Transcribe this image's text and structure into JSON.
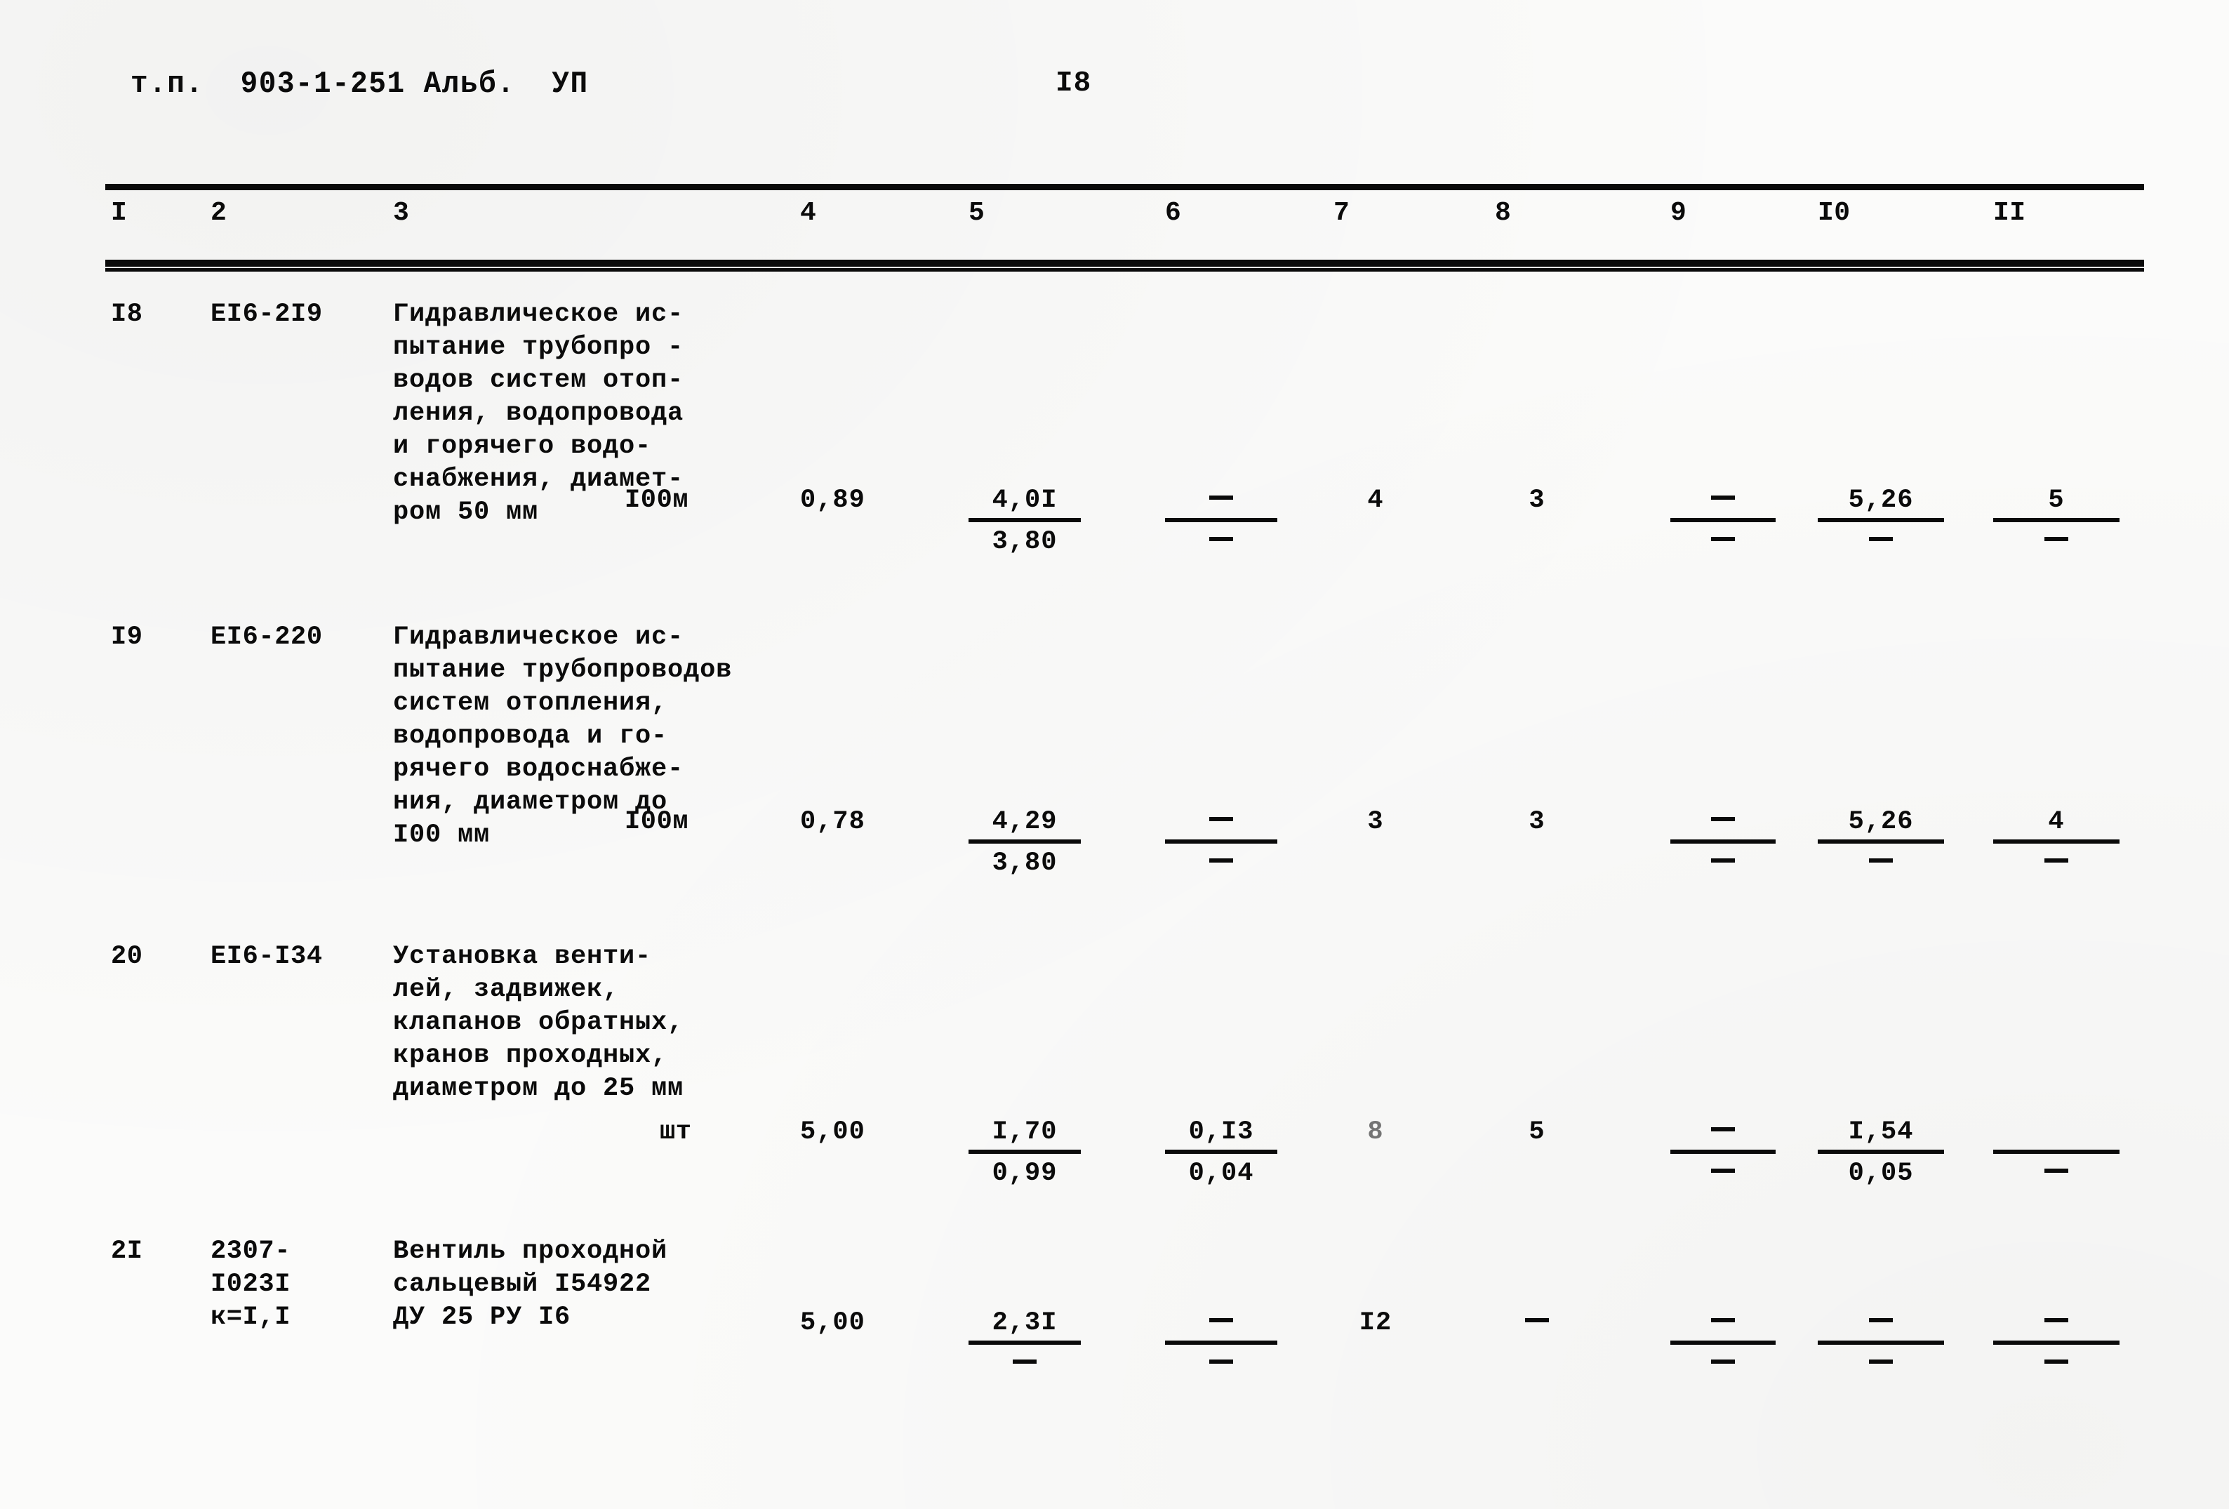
{
  "header": {
    "doc_code": "т.п.  903-1-251 Альб.  УП",
    "page_number": "I8"
  },
  "table": {
    "column_headers": [
      "I",
      "2",
      "3",
      "4",
      "5",
      "6",
      "7",
      "8",
      "9",
      "I0",
      "II"
    ],
    "rows": [
      {
        "no": "I8",
        "code": "ЕI6-2I9",
        "description": "Гидравлическое ис-\nпытание трубопро -\nводов систем отоп-\nления, водопровода\nи горячего водо-\nснабжения, диамет-\nром 50 мм",
        "unit": "I00м",
        "c4": "0,89",
        "c5_top": "4,0I",
        "c5_bot": "3,80",
        "c6_top": "—",
        "c6_bot": "—",
        "c7": "4",
        "c8": "3",
        "c9_top": "—",
        "c9_bot": "—",
        "c10_top": "5,26",
        "c10_bot": "—",
        "c11_top": "5",
        "c11_bot": "—"
      },
      {
        "no": "I9",
        "code": "ЕI6-220",
        "description": "Гидравлическое ис-\nпытание трубопроводов\nсистем отопления,\nводопровода и го-\nрячего водоснабже-\nния, диаметром до\nI00 мм",
        "unit": "I00м",
        "c4": "0,78",
        "c5_top": "4,29",
        "c5_bot": "3,80",
        "c6_top": "—",
        "c6_bot": "—",
        "c7": "3",
        "c8": "3",
        "c9_top": "—",
        "c9_bot": "—",
        "c10_top": "5,26",
        "c10_bot": "—",
        "c11_top": "4",
        "c11_bot": "—"
      },
      {
        "no": "20",
        "code": "ЕI6-I34",
        "description": "Установка венти-\nлей, задвижек,\nклапанов обратных,\nкранов проходных,\nдиаметром до 25 мм",
        "unit": "шт",
        "c4": "5,00",
        "c5_top": "I,70",
        "c5_bot": "0,99",
        "c6_top": "0,I3",
        "c6_bot": "0,04",
        "c7": "8",
        "c8": "5",
        "c9_top": "—",
        "c9_bot": "—",
        "c10_top": "I,54",
        "c10_bot": "0,05",
        "c11_top": "",
        "c11_bot": "—"
      },
      {
        "no": "2I",
        "code": "2307-\nI023I\nк=I,I",
        "description": "Вентиль проходной\nсальцевый I54922\nДУ 25 РУ I6",
        "unit": "",
        "c4": "5,00",
        "c5_top": "2,3I",
        "c5_bot": "—",
        "c6_top": "—",
        "c6_bot": "—",
        "c7": "I2",
        "c8": "—",
        "c9_top": "—",
        "c9_bot": "—",
        "c10_top": "—",
        "c10_bot": "—",
        "c11_top": "—",
        "c11_bot": "—"
      }
    ]
  }
}
